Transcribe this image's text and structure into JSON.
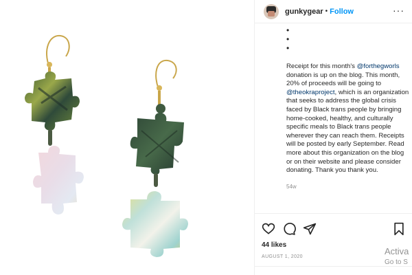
{
  "post": {
    "username": "gunkygear",
    "separator": "•",
    "follow_label": "Follow",
    "more_icon": "more-options-icon",
    "bullets": [
      "•",
      "•",
      "•"
    ],
    "caption": {
      "part1": "Receipt for this month's ",
      "mention1": "@forthegworls",
      "part2": " donation is up on the blog. This month, 20% of proceeds will be going to ",
      "mention2": "@theokraproject",
      "part3": ", which is an organization that seeks to address the global crisis faced by Black trans people by bringing home-cooked, healthy, and culturally specific meals to Black trans people wherever they can reach them. Receipts will be posted by early September. Read more about this organization on the blog or on their website and please consider donating. Thank you thank you."
    },
    "age": "54w",
    "likes": "44 likes",
    "date": "AUGUST 1, 2020",
    "icons": [
      "heart-icon",
      "comment-icon",
      "share-icon",
      "bookmark-icon"
    ]
  },
  "watermark": {
    "title": "Activa",
    "subtitle": "Go to S"
  },
  "colors": {
    "follow": "#0095f6",
    "mention": "#00376b",
    "muted": "#8e8e8e",
    "text": "#262626"
  }
}
